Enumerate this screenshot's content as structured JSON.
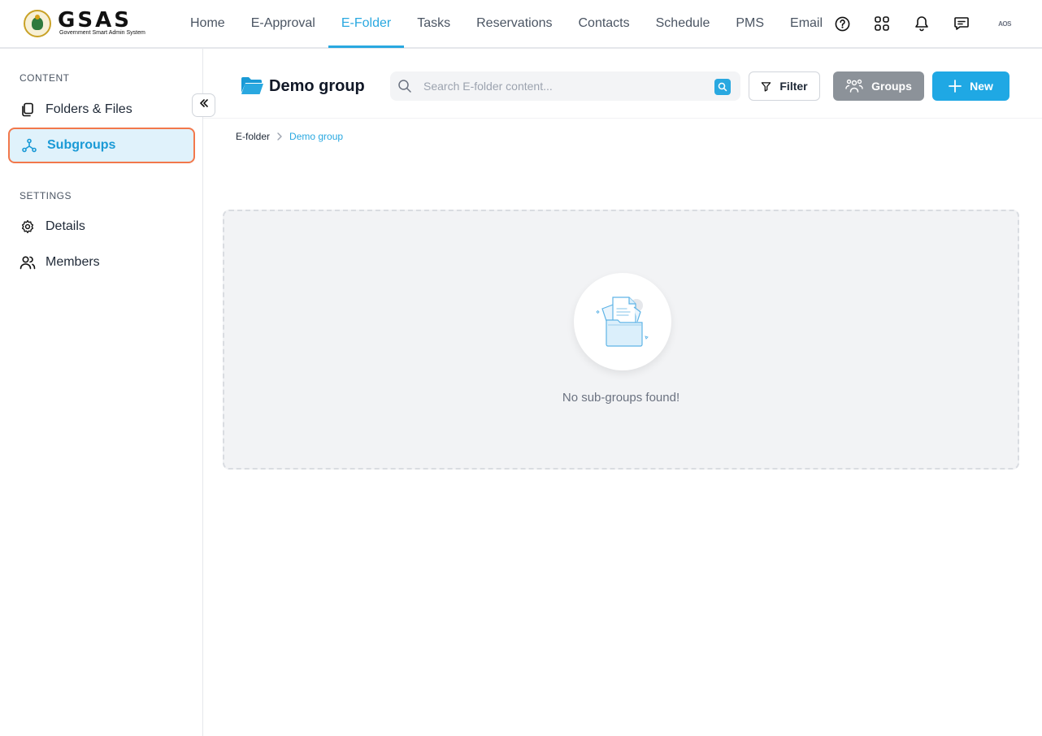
{
  "app": {
    "logo_text": "GSAS",
    "logo_subtitle": "Government Smart Admin System",
    "avatar_initials": "AOS"
  },
  "nav": {
    "items": [
      {
        "label": "Home"
      },
      {
        "label": "E-Approval"
      },
      {
        "label": "E-Folder"
      },
      {
        "label": "Tasks"
      },
      {
        "label": "Reservations"
      },
      {
        "label": "Contacts"
      },
      {
        "label": "Schedule"
      },
      {
        "label": "PMS"
      },
      {
        "label": "Email"
      }
    ],
    "active": "E-Folder"
  },
  "top_icons": [
    "help-icon",
    "apps-grid-icon",
    "bell-icon",
    "chat-icon"
  ],
  "sidebar": {
    "content_heading": "CONTENT",
    "settings_heading": "SETTINGS",
    "items": [
      {
        "label": "Folders & Files",
        "icon": "files-icon"
      },
      {
        "label": "Subgroups",
        "icon": "subgroups-icon"
      },
      {
        "label": "Details",
        "icon": "gear-icon"
      },
      {
        "label": "Members",
        "icon": "members-icon"
      }
    ],
    "active": "Subgroups"
  },
  "header": {
    "title": "Demo group",
    "search_placeholder": "Search E-folder content...",
    "filter_label": "Filter",
    "groups_label": "Groups",
    "new_label": "New"
  },
  "breadcrumb": {
    "root": "E-folder",
    "current": "Demo group"
  },
  "empty_state": {
    "message": "No sub-groups found!"
  },
  "colors": {
    "accent": "#29a8e0",
    "active_outline": "#f2784b",
    "groups_button": "#8c9299"
  }
}
